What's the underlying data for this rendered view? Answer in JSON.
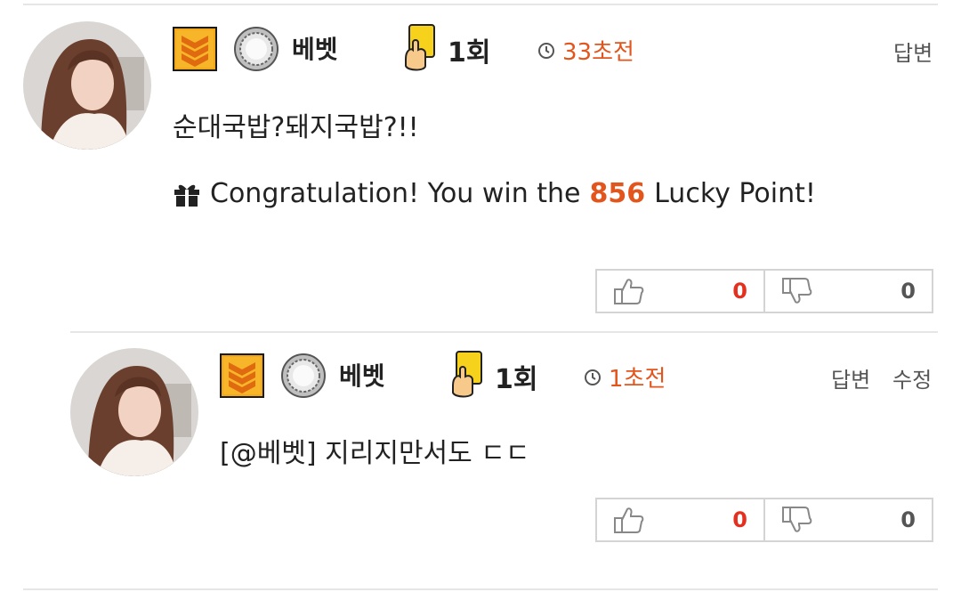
{
  "comments": [
    {
      "nickname": "베벳",
      "card_count": "1회",
      "time": "33초전",
      "actions": [
        "답변"
      ],
      "text": "순대국밥?돼지국밥?!!",
      "lucky": {
        "prefix": "Congratulation! You win the",
        "points": "856",
        "suffix": "Lucky Point!"
      },
      "likes": "0",
      "dislikes": "0"
    },
    {
      "nickname": "베벳",
      "card_count": "1회",
      "time": "1초전",
      "actions": [
        "답변",
        "수정"
      ],
      "mention": "[@베벳]",
      "text": "지리지만서도 ㄷㄷ",
      "likes": "0",
      "dislikes": "0"
    }
  ],
  "icons": {
    "rank": "rank-chevron-icon",
    "medal": "silver-medal-icon",
    "card": "yellow-card-icon",
    "clock": "clock-icon",
    "gift": "gift-icon",
    "like": "thumbs-up-icon",
    "dislike": "thumbs-down-icon"
  },
  "colors": {
    "accent": "#e2561d",
    "like": "#e5301f",
    "rank_bg": "#f3a81c"
  }
}
